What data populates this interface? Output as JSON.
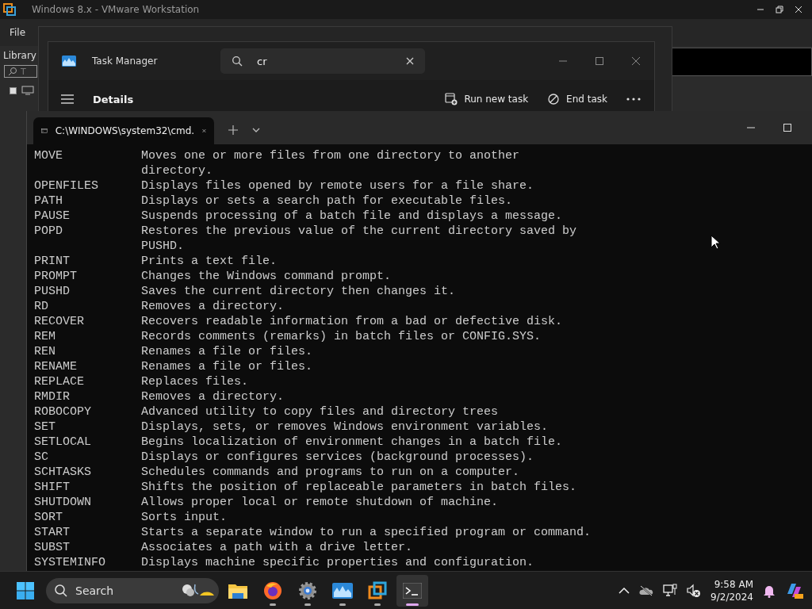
{
  "vmware": {
    "title": "Windows 8.x - VMware Workstation",
    "menu": [
      "File"
    ],
    "library": {
      "title": "Library",
      "search_placeholder": "T"
    }
  },
  "task_manager": {
    "title": "Task Manager",
    "search": {
      "value": "cr"
    },
    "page": "Details",
    "actions": [
      {
        "kind": "run",
        "label": "Run new task"
      },
      {
        "kind": "end",
        "label": "End task"
      }
    ]
  },
  "terminal": {
    "tab_title": "C:\\WINDOWS\\system32\\cmd.",
    "rows": [
      {
        "command": "MOVE",
        "lines": [
          "Moves one or more files from one directory to another",
          "directory."
        ]
      },
      {
        "command": "OPENFILES",
        "lines": [
          "Displays files opened by remote users for a file share."
        ]
      },
      {
        "command": "PATH",
        "lines": [
          "Displays or sets a search path for executable files."
        ]
      },
      {
        "command": "PAUSE",
        "lines": [
          "Suspends processing of a batch file and displays a message."
        ]
      },
      {
        "command": "POPD",
        "lines": [
          "Restores the previous value of the current directory saved by",
          "PUSHD."
        ]
      },
      {
        "command": "PRINT",
        "lines": [
          "Prints a text file."
        ]
      },
      {
        "command": "PROMPT",
        "lines": [
          "Changes the Windows command prompt."
        ]
      },
      {
        "command": "PUSHD",
        "lines": [
          "Saves the current directory then changes it."
        ]
      },
      {
        "command": "RD",
        "lines": [
          "Removes a directory."
        ]
      },
      {
        "command": "RECOVER",
        "lines": [
          "Recovers readable information from a bad or defective disk."
        ]
      },
      {
        "command": "REM",
        "lines": [
          "Records comments (remarks) in batch files or CONFIG.SYS."
        ]
      },
      {
        "command": "REN",
        "lines": [
          "Renames a file or files."
        ]
      },
      {
        "command": "RENAME",
        "lines": [
          "Renames a file or files."
        ]
      },
      {
        "command": "REPLACE",
        "lines": [
          "Replaces files."
        ]
      },
      {
        "command": "RMDIR",
        "lines": [
          "Removes a directory."
        ]
      },
      {
        "command": "ROBOCOPY",
        "lines": [
          "Advanced utility to copy files and directory trees"
        ]
      },
      {
        "command": "SET",
        "lines": [
          "Displays, sets, or removes Windows environment variables."
        ]
      },
      {
        "command": "SETLOCAL",
        "lines": [
          "Begins localization of environment changes in a batch file."
        ]
      },
      {
        "command": "SC",
        "lines": [
          "Displays or configures services (background processes)."
        ]
      },
      {
        "command": "SCHTASKS",
        "lines": [
          "Schedules commands and programs to run on a computer."
        ]
      },
      {
        "command": "SHIFT",
        "lines": [
          "Shifts the position of replaceable parameters in batch files."
        ]
      },
      {
        "command": "SHUTDOWN",
        "lines": [
          "Allows proper local or remote shutdown of machine."
        ]
      },
      {
        "command": "SORT",
        "lines": [
          "Sorts input."
        ]
      },
      {
        "command": "START",
        "lines": [
          "Starts a separate window to run a specified program or command."
        ]
      },
      {
        "command": "SUBST",
        "lines": [
          "Associates a path with a drive letter."
        ]
      },
      {
        "command": "SYSTEMINFO",
        "lines": [
          "Displays machine specific properties and configuration."
        ]
      }
    ]
  },
  "taskbar": {
    "search_placeholder": "Search",
    "apps": [
      {
        "kind": "explorer",
        "active": false
      },
      {
        "kind": "firefox",
        "active": true
      },
      {
        "kind": "settings",
        "active": true
      },
      {
        "kind": "taskmgr",
        "active": true
      },
      {
        "kind": "vmware",
        "active": true
      },
      {
        "kind": "terminal",
        "active": true
      }
    ],
    "time": "9:58 AM",
    "date": "9/2/2024"
  }
}
